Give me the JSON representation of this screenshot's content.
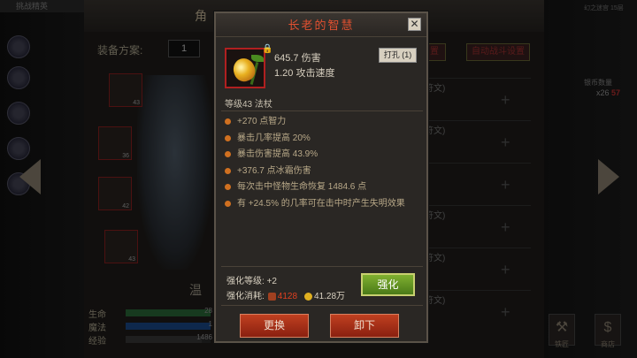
{
  "left_top_text": "挑战精英",
  "mid_title": "角",
  "equip_plan_label": "装备方案:",
  "equip_plan_value": "1",
  "slots": [
    {
      "level": "43"
    },
    {
      "level": "36"
    },
    {
      "level": "42"
    },
    {
      "level": "43"
    }
  ],
  "char_name": "温",
  "stats": [
    {
      "label": "生命",
      "value": "28",
      "fill": 1.0,
      "color": "#2a6a3a"
    },
    {
      "label": "魔法",
      "value": "1",
      "fill": 1.0,
      "color": "#1a4a8a"
    },
    {
      "label": "经验",
      "value": "1486",
      "fill": 0.9,
      "color": "#3a3a3a"
    }
  ],
  "right_buttons": {
    "a": "置",
    "b": "自动战斗设置"
  },
  "rune_rows": [
    "符文)",
    "符文)",
    ")",
    "符文)",
    "符文)",
    "符文)"
  ],
  "far_right": {
    "top": "幻之迷宫 15层",
    "coin_label": "银币数量",
    "count": "x26",
    "count_red": "57",
    "btn1": "铁匠",
    "btn2": "商店"
  },
  "modal": {
    "title": "长老的智慧",
    "close": "✕",
    "damage": "645.7 伤害",
    "speed": "1.20 攻击速度",
    "punch_btn": "打孔 (1)",
    "level_type": "等级43  法杖",
    "attributes": [
      "+270 点智力",
      "暴击几率提高 20%",
      "暴击伤害提高 43.9%",
      "+376.7 点冰霜伤害",
      "每次击中怪物生命恢复 1484.6 点",
      "有 +24.5% 的几率可在击中时产生失明效果"
    ],
    "enhance_level": "强化等级:  +2",
    "enhance_cost_label": "强化消耗:",
    "enhance_cost_a": "4128",
    "enhance_cost_b": "41.28万",
    "enhance_btn": "强化",
    "replace_btn": "更换",
    "unequip_btn": "卸下"
  }
}
